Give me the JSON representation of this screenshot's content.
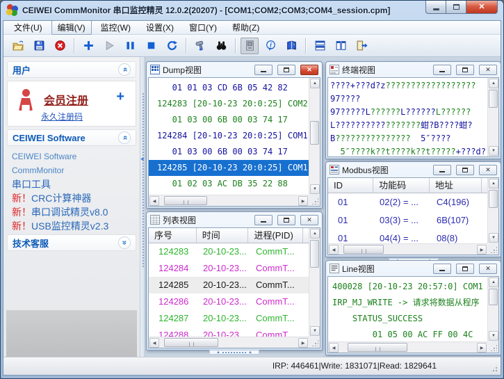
{
  "window": {
    "title": "CEIWEI CommMonitor 串口监控精灵 12.0.2(20207) - [COM1;COM2;COM3;COM4_session.cpm]",
    "control_icons": [
      "minimize-icon",
      "maximize-icon",
      "close-icon"
    ]
  },
  "menu": {
    "items": [
      {
        "label": "文件(U)"
      },
      {
        "label": "编辑(V)",
        "active": true
      },
      {
        "label": "监控(W)"
      },
      {
        "label": "设置(X)"
      },
      {
        "label": "窗口(Y)"
      },
      {
        "label": "帮助(Z)"
      }
    ]
  },
  "toolbar": {
    "groups": [
      [
        "open-file-icon",
        "save-icon",
        "close-session-icon"
      ],
      [
        "add-icon",
        "play-icon",
        "pause-icon",
        "stop-icon",
        "refresh-icon"
      ],
      [
        "tools-hammer-icon",
        "find-binoculars-icon"
      ],
      [
        "device-monitor-icon",
        "info-icon",
        "help-book-icon"
      ],
      [
        "tile-horizontal-icon",
        "tile-vertical-icon",
        "exit-icon"
      ]
    ]
  },
  "sidebar": {
    "user": {
      "title": "用户",
      "register_link": "会员注册",
      "plus": "+",
      "permanent_link": "永久注册码"
    },
    "software": {
      "title": "CEIWEI Software",
      "links": [
        {
          "prefix": "",
          "label": "CEIWEI Software"
        },
        {
          "prefix": "",
          "label": "CommMonitor"
        },
        {
          "prefix": "",
          "label": "串口工具"
        },
        {
          "prefix": "新！",
          "label": "CRC计算神器"
        },
        {
          "prefix": "新！",
          "label": "串口调试精灵v8.0"
        },
        {
          "prefix": "新！",
          "label": "USB监控精灵v2.3"
        }
      ]
    },
    "support": {
      "title": "技术客服"
    }
  },
  "palette": {
    "navy": "#14129e",
    "green": "#1c811c",
    "green2": "#2db42d",
    "magenta": "#cc2acc",
    "black": "#1a1a1a",
    "white": "#ffffff",
    "modbus_navy": "#2a2ab0",
    "selection_blue": "#1770d0"
  },
  "windows": {
    "dump": {
      "title": "Dump视图",
      "lines": [
        {
          "text": "   01 01 03 CD 6B 05 42 82",
          "c": "navy"
        },
        {
          "text": "124283 [20-10-23 20:0:25] COM2",
          "c": "green"
        },
        {
          "text": "   01 03 00 6B 00 03 74 17",
          "c": "green"
        },
        {
          "text": "124284 [20-10-23 20:0:25] COM1",
          "c": "navy"
        },
        {
          "text": "   01 03 00 6B 00 03 74 17",
          "c": "navy"
        },
        {
          "text": "124285 [20-10-23 20:0:25] COM1",
          "c": "white",
          "selected": true
        },
        {
          "text": "   01 02 03 AC DB 35 22 88",
          "c": "green"
        }
      ]
    },
    "terminal": {
      "title": "终端视图",
      "lines": [
        [
          {
            "t": "????+???d?z",
            "c": "navy"
          },
          {
            "t": "??????????????????",
            "c": "green"
          }
        ],
        [
          {
            "t": "97????",
            "c": "navy"
          }
        ],
        [
          {
            "t": "97?????L",
            "c": "navy"
          },
          {
            "t": "??????",
            "c": "green"
          },
          {
            "t": "L??????",
            "c": "navy"
          },
          {
            "t": "L??????",
            "c": "green"
          }
        ],
        [
          {
            "t": "L??????????",
            "c": "navy"
          },
          {
            "t": "???????",
            "c": "green"
          },
          {
            "t": "蚶?B????蚶?",
            "c": "navy"
          }
        ],
        [
          {
            "t": "B",
            "c": "navy"
          },
          {
            "t": "???????????????  ",
            "c": "green"
          },
          {
            "t": "5″????",
            "c": "navy"
          }
        ],
        [
          {
            "t": "  5″????k??t????k??t?????",
            "c": "green"
          },
          {
            "t": "+???d?",
            "c": "navy"
          }
        ]
      ]
    },
    "modbus": {
      "title": "Modbus视图",
      "columns": [
        "ID",
        "功能码",
        "地址"
      ],
      "rows": [
        [
          "01",
          "02(2) = ...",
          "C4(196)"
        ],
        [
          "01",
          "03(3) = ...",
          "6B(107)"
        ],
        [
          "01",
          "04(4) = ...",
          "08(8)"
        ]
      ]
    },
    "list": {
      "title": "列表视图",
      "columns": [
        "序号",
        "时间",
        "进程(PID)"
      ],
      "rows": [
        {
          "seq": "124283",
          "time": "20-10-23...",
          "proc": "CommT...",
          "c": "green2"
        },
        {
          "seq": "124284",
          "time": "20-10-23...",
          "proc": "CommT...",
          "c": "magenta"
        },
        {
          "seq": "124285",
          "time": "20-10-23...",
          "proc": "CommT...",
          "c": "black",
          "selected": true
        },
        {
          "seq": "124286",
          "time": "20-10-23...",
          "proc": "CommT...",
          "c": "magenta"
        },
        {
          "seq": "124287",
          "time": "20-10-23...",
          "proc": "CommT...",
          "c": "green2"
        },
        {
          "seq": "124288",
          "time": "20-10-23",
          "proc": "CommT",
          "c": "magenta"
        }
      ]
    },
    "line": {
      "title": "Line视图",
      "lines": [
        "400028 [20-10-23 20:57:0] COM1",
        "IRP_MJ_WRITE -> 请求将数据从程序",
        "    STATUS_SUCCESS",
        "        01 05 00 AC FF 00 4C"
      ]
    }
  },
  "statusbar": {
    "text": "IRP: 446461|Write: 1831071|Read: 1829641"
  }
}
